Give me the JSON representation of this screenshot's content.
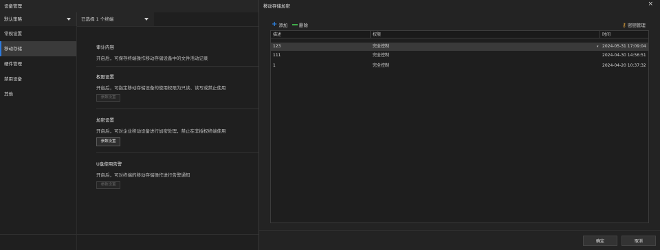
{
  "left": {
    "title": "设备管理",
    "policy_select": "默认策略",
    "terminal_select": "已选择 1 个终端",
    "sidebar": [
      {
        "label": "常规设置"
      },
      {
        "label": "移动存储"
      },
      {
        "label": "硬件管理"
      },
      {
        "label": "禁用设备"
      },
      {
        "label": "其他"
      }
    ],
    "sections": {
      "audit": {
        "title": "审计内容",
        "desc": "开启后，可保存终端操作移动存储设备中的文件活动记录"
      },
      "permission": {
        "title": "权限设置",
        "desc": "开启后，可指定移动存储设备的使用权限为只读、读写或禁止使用",
        "button": "参数设置"
      },
      "encrypt": {
        "title": "加密设置",
        "desc": "开启后，可对企业移动设备进行加密处理，禁止在非授权终端使用",
        "button": "参数设置"
      },
      "alert": {
        "title": "U盘使用告警",
        "desc": "开启后，可对终端的移动存储操作进行告警通知",
        "button": "参数设置"
      }
    }
  },
  "dialog": {
    "title": "移动存储加密",
    "close": "×",
    "toolbar": {
      "add": "添加",
      "delete": "删除",
      "key_manage": "密钥管理"
    },
    "columns": [
      "描述",
      "权限",
      "时间"
    ],
    "rows": [
      {
        "desc": "123",
        "perm": "完全控制",
        "time": "2024-05-31 17:09:04"
      },
      {
        "desc": "111",
        "perm": "完全控制",
        "time": "2024-04-30 14:56:51"
      },
      {
        "desc": "1",
        "perm": "完全控制",
        "time": "2024-04-20 10:37:32"
      }
    ],
    "ok": "确定",
    "cancel": "取消"
  },
  "colors": {
    "accent": "#2d7be0",
    "add_icon": "#2d86e8",
    "delete_icon": "#3fae4a",
    "key_icon": "#e0a23a"
  }
}
